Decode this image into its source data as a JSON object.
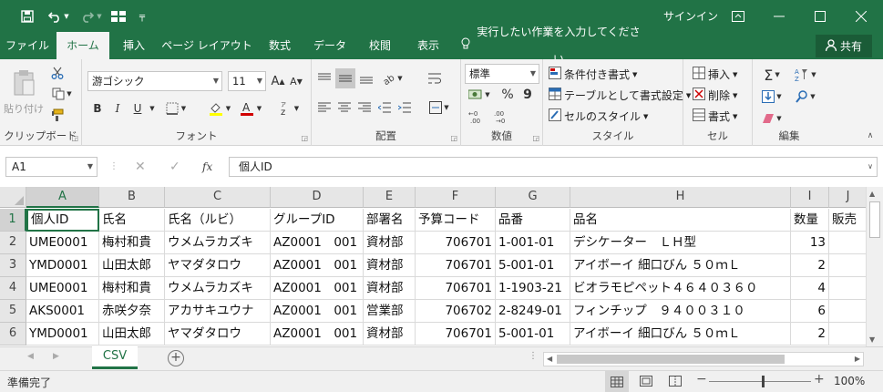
{
  "titlebar": {
    "signin": "サインイン",
    "undo_icon": "undo-icon",
    "redo_icon": "redo-icon"
  },
  "tabs": [
    {
      "label": "ファイル"
    },
    {
      "label": "ホーム"
    },
    {
      "label": "挿入"
    },
    {
      "label": "ページ レイアウト"
    },
    {
      "label": "数式"
    },
    {
      "label": "データ"
    },
    {
      "label": "校閲"
    },
    {
      "label": "表示"
    }
  ],
  "tell_me": "実行したい作業を入力してください",
  "share": "共有",
  "ribbon": {
    "clipboard": {
      "label": "クリップボード",
      "paste": "貼り付け"
    },
    "font": {
      "label": "フォント",
      "name": "游ゴシック",
      "size": "11",
      "bold": "B",
      "italic": "I",
      "underline": "U",
      "grow": "A",
      "shrink": "A"
    },
    "alignment": {
      "label": "配置"
    },
    "number": {
      "label": "数値",
      "format": "標準",
      "percent": "%",
      "comma": "9"
    },
    "styles": {
      "label": "スタイル",
      "conditional": "条件付き書式",
      "table": "テーブルとして書式設定",
      "cell": "セルのスタイル"
    },
    "cells": {
      "label": "セル",
      "insert": "挿入",
      "delete": "削除",
      "format": "書式"
    },
    "editing": {
      "label": "編集"
    }
  },
  "formula": {
    "namebox": "A1",
    "content": "個人ID"
  },
  "columns": [
    "A",
    "B",
    "C",
    "D",
    "E",
    "F",
    "G",
    "H",
    "I",
    "J"
  ],
  "rows": [
    "1",
    "2",
    "3",
    "4",
    "5",
    "6"
  ],
  "cells": [
    [
      "個人ID",
      "氏名",
      "氏名（ルビ）",
      "グループID",
      "部署名",
      "予算コード",
      "品番",
      "品名",
      "数量",
      "販売"
    ],
    [
      "UME0001",
      "梅村和貴",
      "ウメムラカズキ",
      "AZ0001　001",
      "資材部",
      "706701",
      "1-001-01",
      "デシケーター　ＬＨ型",
      "13",
      ""
    ],
    [
      "YMD0001",
      "山田太郎",
      "ヤマダタロウ",
      "AZ0001　001",
      "資材部",
      "706701",
      "5-001-01",
      "アイボーイ 細口びん ５０ｍＬ",
      "2",
      ""
    ],
    [
      "UME0001",
      "梅村和貴",
      "ウメムラカズキ",
      "AZ0001　001",
      "資材部",
      "706701",
      "1-1903-21",
      "ビオラモピペット４６４０３６０",
      "4",
      ""
    ],
    [
      "AKS0001",
      "赤咲夕奈",
      "アカサキユウナ",
      "AZ0001　001",
      "営業部",
      "706702",
      "2-8249-01",
      "フィンチップ　９４００３１０",
      "6",
      ""
    ],
    [
      "YMD0001",
      "山田太郎",
      "ヤマダタロウ",
      "AZ0001　001",
      "資材部",
      "706701",
      "5-001-01",
      "アイボーイ 細口びん ５０ｍＬ",
      "2",
      ""
    ]
  ],
  "sheet": {
    "name": "CSV"
  },
  "status": {
    "text": "準備完了",
    "zoom": "100%"
  }
}
